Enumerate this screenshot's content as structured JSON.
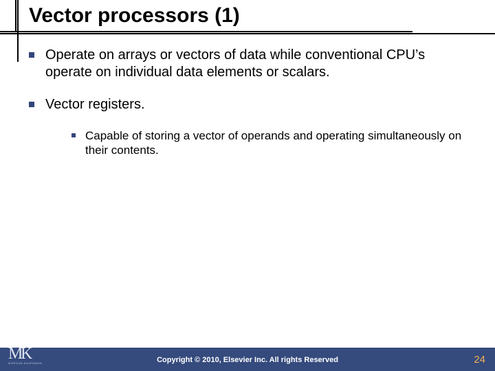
{
  "title": "Vector processors (1)",
  "bullets": [
    {
      "text": "Operate on arrays or vectors of data while conventional CPU’s operate on individual data elements or scalars."
    },
    {
      "text": "Vector registers."
    }
  ],
  "sub_bullets": [
    {
      "text": "Capable of storing a vector of operands and operating simultaneously on their contents."
    }
  ],
  "footer": {
    "copyright": "Copyright © 2010, Elsevier Inc. All rights Reserved",
    "page": "24",
    "logo_text": "MK",
    "logo_sub": "MORGAN KAUFMANN"
  },
  "colors": {
    "accent": "#354a7d",
    "bullet": "#33457a",
    "page_num": "#f1b156"
  }
}
